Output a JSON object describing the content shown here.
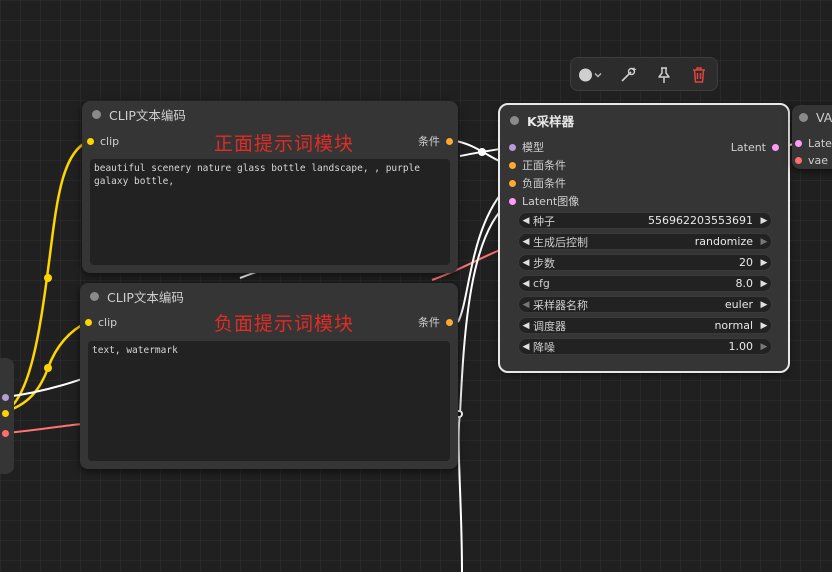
{
  "toolbar": {
    "color_icon": "color-circle-icon",
    "color_value": "#cfcfcf",
    "icons": [
      "color-circle-icon",
      "chevron-down-icon",
      "bypass-wand-icon",
      "pin-icon",
      "trash-icon"
    ],
    "delete_color": "#e2453c"
  },
  "positive_node": {
    "title": "CLIP文本编码",
    "input_label": "clip",
    "output_label": "条件",
    "annotation": "正面提示词模块",
    "prompt": "beautiful scenery nature glass bottle landscape, , purple galaxy bottle,"
  },
  "negative_node": {
    "title": "CLIP文本编码",
    "input_label": "clip",
    "output_label": "条件",
    "annotation": "负面提示词模块",
    "prompt": "text, watermark"
  },
  "ksampler": {
    "title": "K采样器",
    "inputs": [
      "模型",
      "正面条件",
      "负面条件",
      "Latent图像"
    ],
    "output_label": "Latent",
    "widgets": [
      {
        "label": "种子",
        "value": "556962203553691"
      },
      {
        "label": "生成后控制",
        "value": "randomize"
      },
      {
        "label": "步数",
        "value": "20"
      },
      {
        "label": "cfg",
        "value": "8.0"
      },
      {
        "label": "采样器名称",
        "value": "euler"
      },
      {
        "label": "调度器",
        "value": "normal"
      },
      {
        "label": "降噪",
        "value": "1.00"
      }
    ]
  },
  "vae_node": {
    "title": "VA",
    "inputs": [
      "Laten",
      "vae"
    ]
  },
  "colors": {
    "clip": "#ffd500",
    "conditioning": "#ffa931",
    "model": "#b39ddb",
    "latent": "#ff9cf9",
    "vae": "#ff6e6e",
    "annotation": "#e12c25"
  }
}
